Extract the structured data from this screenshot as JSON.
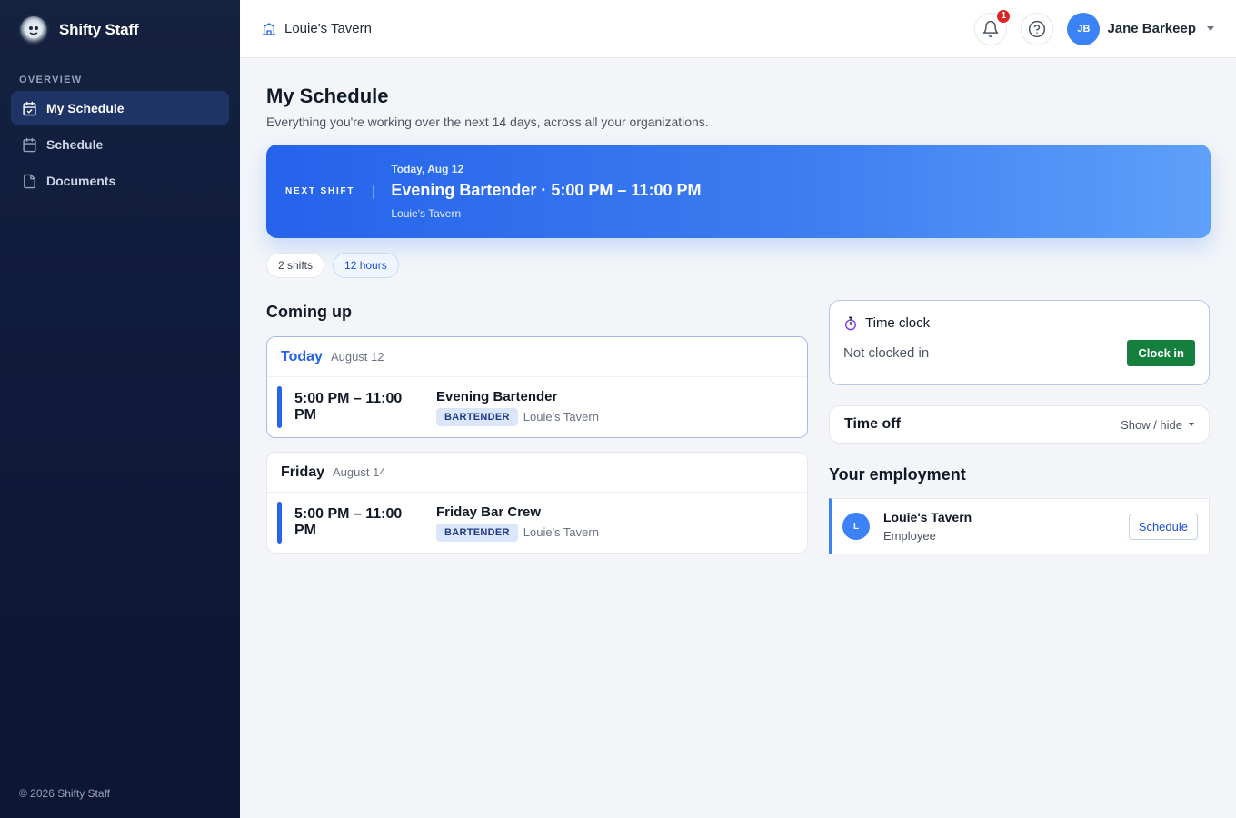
{
  "brand": {
    "name": "Shifty Staff"
  },
  "sidebar": {
    "section_label": "OVERVIEW",
    "items": [
      {
        "label": "My Schedule",
        "icon": "calendar-check-icon",
        "active": true
      },
      {
        "label": "Schedule",
        "icon": "calendar-icon",
        "active": false
      },
      {
        "label": "Documents",
        "icon": "document-icon",
        "active": false
      }
    ],
    "footer": "© 2026 Shifty Staff"
  },
  "header": {
    "org_name": "Louie's Tavern",
    "notification_count": "1",
    "user": {
      "initials": "JB",
      "name": "Jane Barkeep"
    }
  },
  "page": {
    "title": "My Schedule",
    "subtitle": "Everything you're working over the next 14 days, across all your organizations."
  },
  "next_shift": {
    "label": "NEXT SHIFT",
    "date": "Today, Aug 12",
    "title": "Evening Bartender · 5:00 PM – 11:00 PM",
    "location": "Louie's Tavern"
  },
  "summary": {
    "shifts": "2 shifts",
    "hours": "12 hours"
  },
  "coming_up": {
    "title": "Coming up",
    "days": [
      {
        "day": "Today",
        "date": "August 12",
        "shift": {
          "time": "5:00 PM – 11:00 PM",
          "name": "Evening Bartender",
          "role": "BARTENDER",
          "location": "Louie's Tavern"
        }
      },
      {
        "day": "Friday",
        "date": "August 14",
        "shift": {
          "time": "5:00 PM – 11:00 PM",
          "name": "Friday Bar Crew",
          "role": "BARTENDER",
          "location": "Louie's Tavern"
        }
      }
    ]
  },
  "time_clock": {
    "title": "Time clock",
    "status": "Not clocked in",
    "button": "Clock in"
  },
  "time_off": {
    "title": "Time off",
    "toggle": "Show / hide"
  },
  "employment": {
    "title": "Your employment",
    "items": [
      {
        "initial": "L",
        "org": "Louie's Tavern",
        "role": "Employee",
        "button": "Schedule"
      }
    ]
  },
  "colors": {
    "accent": "#2563eb",
    "sidebar": "#14213f",
    "clock_in": "#15803d",
    "badge": "#dc2626"
  }
}
